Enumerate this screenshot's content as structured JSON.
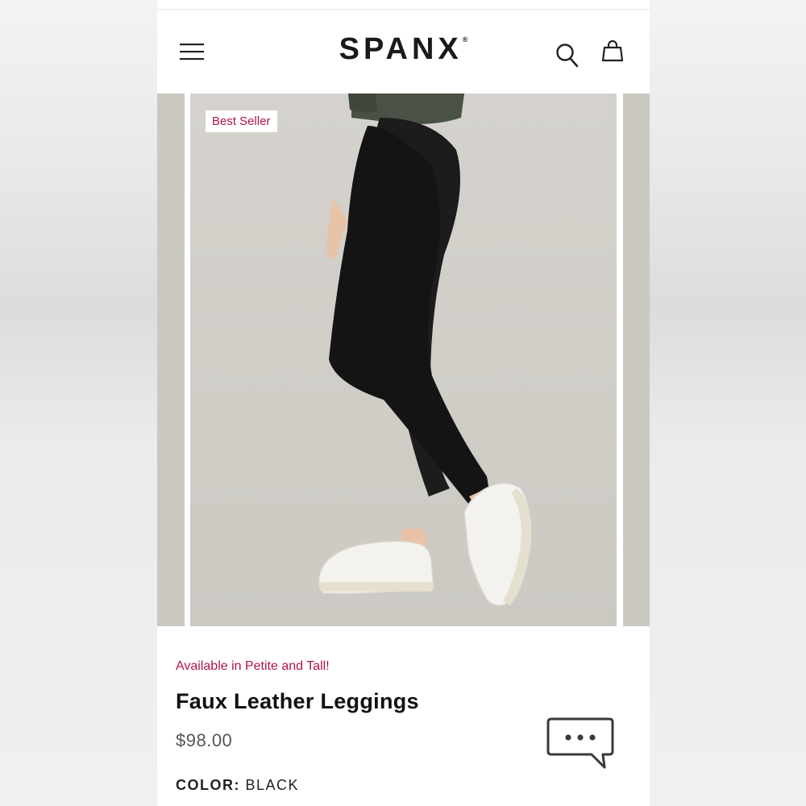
{
  "header": {
    "brand": "SPANX",
    "brand_mark": "®"
  },
  "carousel": {
    "badge": "Best Seller"
  },
  "product": {
    "promo": "Available in Petite and Tall!",
    "title": "Faux Leather Leggings",
    "price": "$98.00",
    "color_label": "COLOR:",
    "color_value": "BLACK"
  },
  "icons": {
    "menu": "hamburger-menu-icon",
    "search": "search-icon",
    "bag": "shopping-bag-icon",
    "chat": "chat-bubble-icon"
  },
  "colors": {
    "accent": "#b0144a",
    "text": "#111111",
    "price": "#555555",
    "photo_bg": "#d0cdc7"
  }
}
